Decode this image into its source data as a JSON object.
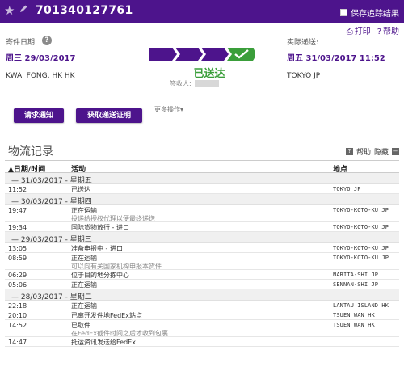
{
  "header": {
    "tracking_number": "701340127761",
    "save_label": "保存追踪结果"
  },
  "actions": {
    "print": "打印",
    "help": "帮助"
  },
  "ship": {
    "label": "寄件日期:",
    "date": "周三 29/03/2017",
    "place": "KWAI FONG, HK HK"
  },
  "delivery": {
    "label": "实际递送:",
    "date": "周五 31/03/2017 11:52",
    "place": "TOKYO JP"
  },
  "status": {
    "text": "已送达",
    "signer_label": "签收人:"
  },
  "buttons": {
    "notify": "请求通知",
    "proof": "获取递送证明",
    "more": "更多操作▾"
  },
  "history": {
    "title": "物流记录",
    "help": "帮助",
    "hide": "隐藏",
    "col_datetime": "▲日期/时间",
    "col_activity": "活动",
    "col_location": "地点",
    "groups": [
      {
        "date": "—  31/03/2017 - 星期五",
        "events": [
          {
            "time": "11:52",
            "activity": "已送达",
            "sub": "",
            "location": "TOKYO JP"
          }
        ]
      },
      {
        "date": "—  30/03/2017 - 星期四",
        "events": [
          {
            "time": "19:47",
            "activity": "正在运输",
            "sub": "投递给授权代理以便最终递送",
            "location": "TOKYO-KOTO-KU JP"
          },
          {
            "time": "19:34",
            "activity": "国际货物放行 - 进口",
            "sub": "",
            "location": "TOKYO-KOTO-KU JP"
          }
        ]
      },
      {
        "date": "—  29/03/2017 - 星期三",
        "events": [
          {
            "time": "13:05",
            "activity": "准备申报中 - 进口",
            "sub": "",
            "location": "TOKYO-KOTO-KU JP"
          },
          {
            "time": "08:59",
            "activity": "正在运输",
            "sub": "可以向有关国家机构申报本货件",
            "location": "TOKYO-KOTO-KU JP"
          },
          {
            "time": "06:29",
            "activity": "位于目的地分拣中心",
            "sub": "",
            "location": "NARITA-SHI JP"
          },
          {
            "time": "05:06",
            "activity": "正在运输",
            "sub": "",
            "location": "SENNAN-SHI JP"
          }
        ]
      },
      {
        "date": "—  28/03/2017 - 星期二",
        "events": [
          {
            "time": "22:18",
            "activity": "正在运输",
            "sub": "",
            "location": "LANTAU ISLAND HK"
          },
          {
            "time": "20:10",
            "activity": "已离开发件地FedEx站点",
            "sub": "",
            "location": "TSUEN WAN HK"
          },
          {
            "time": "14:52",
            "activity": "已取件",
            "sub": "在FedEx截件时间之后才收到包裹",
            "location": "TSUEN WAN HK"
          },
          {
            "time": "14:47",
            "activity": "托运资讯发送给FedEx",
            "sub": "",
            "location": ""
          }
        ]
      }
    ]
  },
  "colors": {
    "brand": "#4d148c",
    "delivered": "#3a9e3a"
  }
}
